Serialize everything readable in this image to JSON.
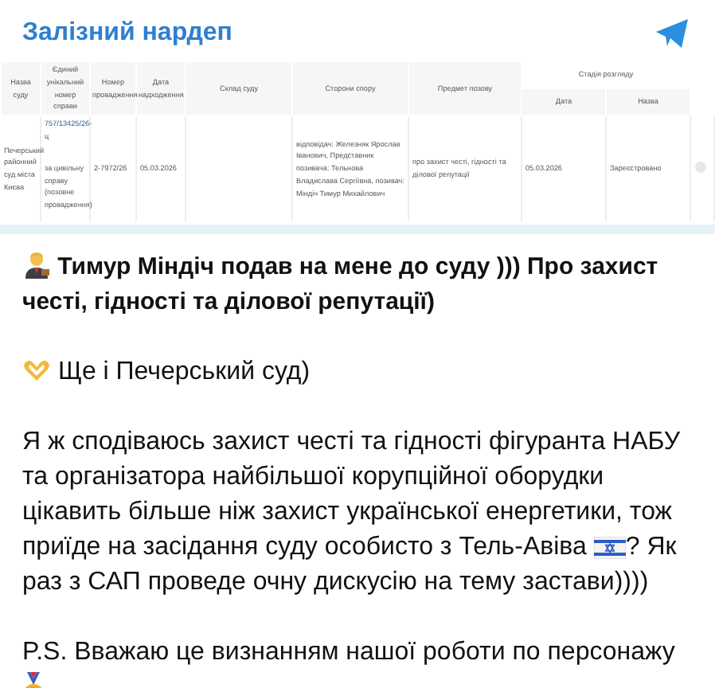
{
  "channel": {
    "title": "Залізний нардеп"
  },
  "court_table": {
    "columns": [
      {
        "label": "Назва суду"
      },
      {
        "label": "Єдиний унікальний номер справи"
      },
      {
        "label": "Номер провадження"
      },
      {
        "label": "Дата надходження"
      },
      {
        "label": "Склад суду"
      },
      {
        "label": "Сторони спору"
      },
      {
        "label": "Предмет позову"
      }
    ],
    "stage_header": "Стадія розгляду",
    "stage_columns": [
      "Дата",
      "Назва"
    ],
    "row": {
      "court": "Печерський районний суд міста Києва",
      "case_number": "757/13425/26-ц",
      "case_type": "за цивільну справу (позовне провадження)",
      "proceeding_number": "2-7972/26",
      "received_date": "05.03.2026",
      "parties": "відповідач: Железняк Ярослав Іванович, Представник позивача: Тельнова Владислава Сергіївна, позивач: Міндіч Тимур Михайлович",
      "subject": "про захист честі, гідності та ділової репутації",
      "stage_date": "05.03.2026",
      "stage_name": "Зареєстровано"
    }
  },
  "post": [
    {
      "kind": "headline",
      "lines": [
        "Тимур Міндіч подав на мене до суду ))) Про захист",
        "честі, гідності та ділової репутації)"
      ]
    },
    {
      "kind": "note",
      "lines": [
        "Ще і Печерський суд)"
      ]
    },
    {
      "kind": "flag",
      "lines": [
        "Я ж сподіваюсь захист честі та гідності фігуранта НАБУ",
        "та організатора найбільшої корупційної оборудки",
        "цікавить більше ніж захист української енергетики, тож",
        "приїде на засідання суду особисто з Тель-Авіва",
        "? Як",
        "раз з САП проведе очну дискусію на тему застави))))"
      ]
    },
    {
      "kind": "signoff",
      "lines": [
        "P.S. Вважаю це визнанням нашої роботи по персонажу"
      ]
    }
  ]
}
